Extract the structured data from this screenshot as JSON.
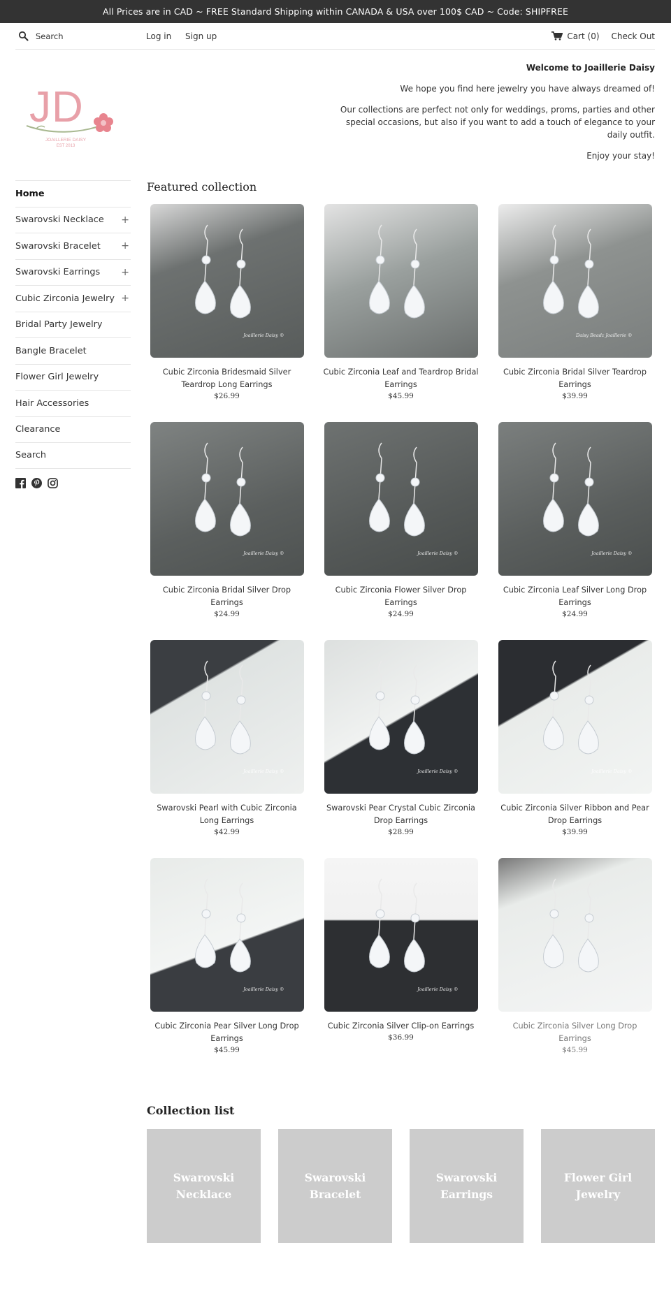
{
  "announcement": "All Prices are in CAD ~ FREE Standard Shipping within CANADA & USA over 100$ CAD ~ Code: SHIPFREE",
  "topbar": {
    "search_placeholder": "Search",
    "login": "Log in",
    "signup": "Sign up",
    "cart": "Cart (0)",
    "checkout": "Check Out"
  },
  "logo": {
    "monogram": "JD",
    "name": "JOAILLERIE DAISY",
    "est": "EST 2013"
  },
  "welcome": {
    "heading": "Welcome to Joaillerie Daisy",
    "line1": "We hope you find here jewelry you have always dreamed of!",
    "line2": "Our collections are perfect not only for weddings, proms, parties and other special occasions, but also if you want to add a touch of elegance to your daily outfit.",
    "line3": "Enjoy your stay!"
  },
  "sidebar": {
    "items": [
      {
        "label": "Home",
        "plus": ""
      },
      {
        "label": "Swarovski Necklace",
        "plus": "+"
      },
      {
        "label": "Swarovski Bracelet",
        "plus": "+"
      },
      {
        "label": "Swarovski Earrings",
        "plus": "+"
      },
      {
        "label": "Cubic Zirconia Jewelry",
        "plus": "+"
      },
      {
        "label": "Bridal Party Jewelry",
        "plus": ""
      },
      {
        "label": "Bangle Bracelet",
        "plus": ""
      },
      {
        "label": "Flower Girl Jewelry",
        "plus": ""
      },
      {
        "label": "Hair Accessories",
        "plus": ""
      },
      {
        "label": "Clearance",
        "plus": ""
      },
      {
        "label": "Search",
        "plus": ""
      }
    ],
    "social_icons": [
      "facebook-icon",
      "pinterest-icon",
      "instagram-icon"
    ]
  },
  "featured": {
    "title": "Featured collection",
    "products": [
      {
        "title": "Cubic Zirconia Bridesmaid Silver Teardrop Long Earrings",
        "price": "$26.99",
        "watermark": "Joaillerie Daisy ©"
      },
      {
        "title": "Cubic Zirconia Leaf and Teardrop Bridal Earrings",
        "price": "$45.99",
        "watermark": ""
      },
      {
        "title": "Cubic Zirconia Bridal Silver Teardrop Earrings",
        "price": "$39.99",
        "watermark": "Daisy Beadz Joaillerie ©"
      },
      {
        "title": "Cubic Zirconia Bridal Silver Drop Earrings",
        "price": "$24.99",
        "watermark": "Joaillerie Daisy ©"
      },
      {
        "title": "Cubic Zirconia Flower Silver Drop Earrings",
        "price": "$24.99",
        "watermark": "Joaillerie Daisy ©"
      },
      {
        "title": "Cubic Zirconia Leaf Silver Long Drop Earrings",
        "price": "$24.99",
        "watermark": "Joaillerie Daisy ©"
      },
      {
        "title": "Swarovski Pearl with Cubic Zirconia Long Earrings",
        "price": "$42.99",
        "watermark": "Joaillerie Daisy ©"
      },
      {
        "title": "Swarovski Pear Crystal Cubic Zirconia Drop Earrings",
        "price": "$28.99",
        "watermark": "Joaillerie Daisy ©"
      },
      {
        "title": "Cubic Zirconia Silver Ribbon and Pear Drop Earrings",
        "price": "$39.99",
        "watermark": "Joaillerie Daisy ©"
      },
      {
        "title": "Cubic Zirconia Pear Silver Long Drop Earrings",
        "price": "$45.99",
        "watermark": "Joaillerie Daisy ©"
      },
      {
        "title": "Cubic Zirconia Silver Clip-on Earrings",
        "price": "$36.99",
        "watermark": "Joaillerie Daisy ©"
      },
      {
        "title": "Cubic Zirconia Silver Long Drop Earrings",
        "price": "$45.99",
        "watermark": ""
      }
    ]
  },
  "collections": {
    "title": "Collection list",
    "items": [
      "Swarovski Necklace",
      "Swarovski Bracelet",
      "Swarovski Earrings",
      "Flower Girl Jewelry"
    ]
  },
  "colors": {
    "announcement_bg": "#333333",
    "logo_pink": "#e8a0a8",
    "collection_tile": "#cccccc"
  }
}
